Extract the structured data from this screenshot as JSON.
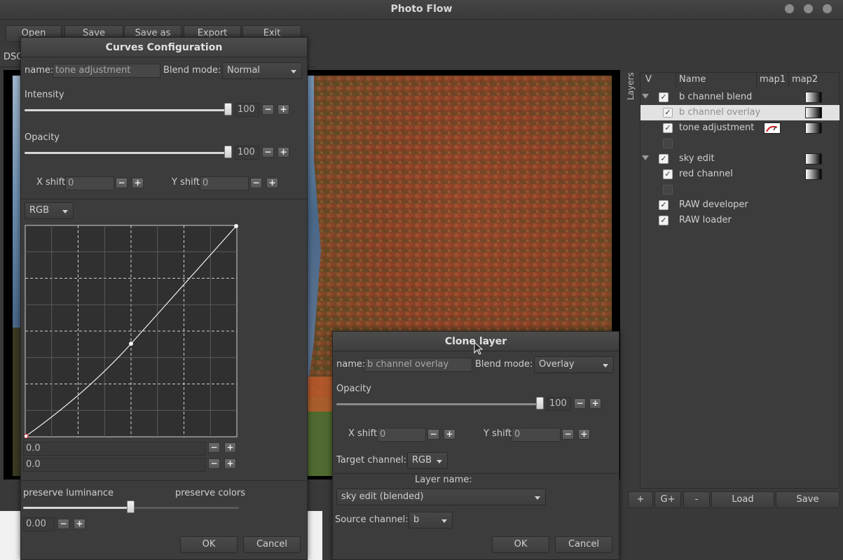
{
  "app": {
    "title": "Photo Flow"
  },
  "toolbar": {
    "open": "Open",
    "save": "Save",
    "save_as": "Save as",
    "export": "Export",
    "exit": "Exit"
  },
  "tab": {
    "label": "DSC"
  },
  "layers": {
    "panel_title": "Layers",
    "col_v": "V",
    "col_name": "Name",
    "col_map1": "map1",
    "col_map2": "map2",
    "rows": [
      {
        "name": "b channel blend",
        "checked": true
      },
      {
        "name": "b channel overlay",
        "checked": true,
        "selected": true
      },
      {
        "name": "tone adjustment",
        "checked": true
      },
      {
        "name": "",
        "checked": false
      },
      {
        "name": "sky edit",
        "checked": true
      },
      {
        "name": "red channel",
        "checked": true
      },
      {
        "name": "",
        "checked": false
      },
      {
        "name": "RAW developer",
        "checked": true
      },
      {
        "name": "RAW loader",
        "checked": true
      }
    ],
    "buttons": {
      "add": "+",
      "group": "G+",
      "remove": "-",
      "load": "Load",
      "save": "Save"
    }
  },
  "curves": {
    "title": "Curves Configuration",
    "name_label": "name:",
    "name_value": "tone adjustment",
    "blend_label": "Blend mode:",
    "blend_value": "Normal",
    "intensity_label": "Intensity",
    "intensity_value": "100",
    "intensity_level": 1.0,
    "opacity_label": "Opacity",
    "opacity_value": "100",
    "opacity_level": 1.0,
    "xshift_label": "X shift",
    "xshift_value": "0",
    "yshift_label": "Y shift",
    "yshift_value": "0",
    "channel_value": "RGB",
    "point_x_value": "0.0",
    "point_y_value": "0.0",
    "preserve_left": "preserve luminance",
    "preserve_right": "preserve colors",
    "preserve_value": "0.00",
    "preserve_level": 0.5,
    "ok": "OK",
    "cancel": "Cancel"
  },
  "clone": {
    "title": "Clone layer",
    "name_label": "name:",
    "name_value": "b channel overlay",
    "blend_label": "Blend mode:",
    "blend_value": "Overlay",
    "opacity_label": "Opacity",
    "opacity_value": "100",
    "opacity_level": 1.0,
    "xshift_label": "X shift",
    "xshift_value": "0",
    "yshift_label": "Y shift",
    "yshift_value": "0",
    "target_label": "Target channel:",
    "target_value": "RGB",
    "layer_name_label": "Layer name:",
    "layer_name_value": "sky edit (blended)",
    "source_label": "Source channel:",
    "source_value": "b",
    "ok": "OK",
    "cancel": "Cancel"
  },
  "colors": {
    "window_bg": "#393939",
    "dialog_bg": "#3c3c3c",
    "selected_row": "#e2e2e2",
    "curve_point_end": "#d03030"
  },
  "icons": {
    "checkbox": "check-icon",
    "expander": "triangle-down-icon",
    "combo": "chevron-down-icon"
  }
}
